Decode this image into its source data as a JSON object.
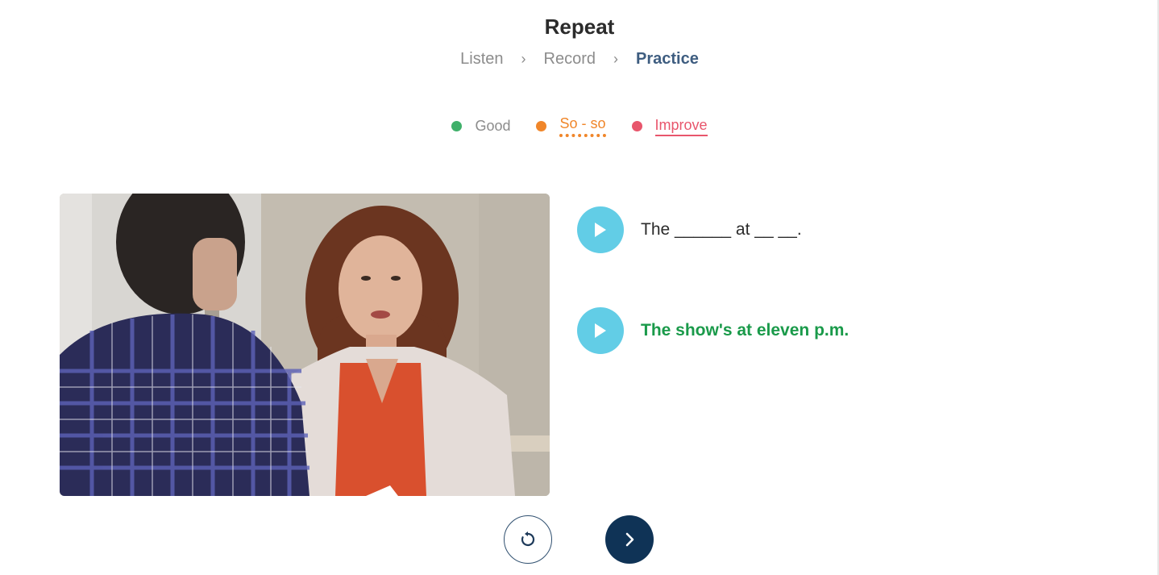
{
  "header": {
    "title": "Repeat",
    "steps": [
      {
        "label": "Listen",
        "state": "inactive"
      },
      {
        "label": "Record",
        "state": "inactive"
      },
      {
        "label": "Practice",
        "state": "active"
      }
    ],
    "step_separator": "›"
  },
  "legend": [
    {
      "label": "Good",
      "color": "#3fb06a"
    },
    {
      "label": "So - so",
      "color": "#f0862a"
    },
    {
      "label": "Improve",
      "color": "#e8566c"
    }
  ],
  "video": {
    "description_icon": "video-frame"
  },
  "lines": [
    {
      "text": "The ______ at __ __.",
      "icon": "play-icon"
    },
    {
      "text": "The show's at eleven p.m.",
      "icon": "play-icon"
    }
  ],
  "controls": {
    "replay_icon": "replay-icon",
    "next_icon": "chevron-right-icon"
  },
  "colors": {
    "accent": "#62cde6",
    "primary_dark": "#0f3356",
    "answer_green": "#1a9a4a"
  }
}
